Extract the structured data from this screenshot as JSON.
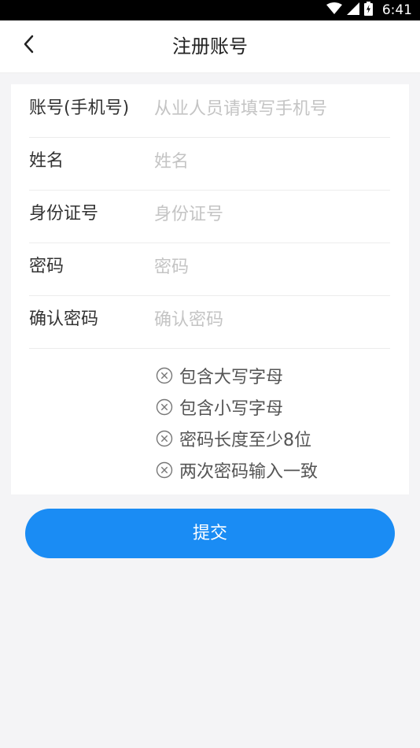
{
  "status_bar": {
    "time": "6:41",
    "icons": [
      "wifi-icon",
      "cellular-signal-icon",
      "battery-charging-icon"
    ]
  },
  "header": {
    "back_icon": "chevron-left-icon",
    "title": "注册账号"
  },
  "form": {
    "fields": [
      {
        "label": "账号(手机号)",
        "placeholder": "从业人员请填写手机号",
        "value": ""
      },
      {
        "label": "姓名",
        "placeholder": "姓名",
        "value": ""
      },
      {
        "label": "身份证号",
        "placeholder": "身份证号",
        "value": ""
      },
      {
        "label": "密码",
        "placeholder": "密码",
        "value": ""
      },
      {
        "label": "确认密码",
        "placeholder": "确认密码",
        "value": ""
      }
    ],
    "password_rules": [
      {
        "text": "包含大写字母",
        "icon": "circle-x-icon"
      },
      {
        "text": "包含小写字母",
        "icon": "circle-x-icon"
      },
      {
        "text": "密码长度至少8位",
        "icon": "circle-x-icon"
      },
      {
        "text": "两次密码输入一致",
        "icon": "circle-x-icon"
      }
    ]
  },
  "submit": {
    "label": "提交"
  },
  "colors": {
    "accent": "#1a8cf4",
    "background": "#f4f4f6",
    "placeholder": "#c4c4c4"
  }
}
